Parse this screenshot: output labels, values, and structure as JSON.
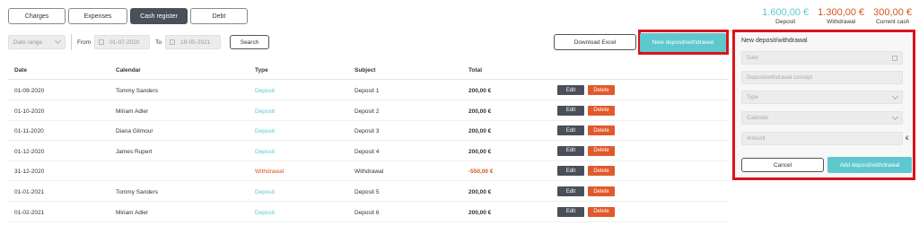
{
  "tabs": [
    {
      "label": "Charges"
    },
    {
      "label": "Expenses"
    },
    {
      "label": "Cash register"
    },
    {
      "label": "Debt"
    }
  ],
  "totals": {
    "deposit": {
      "amount": "1.600,00 €",
      "caption": "Deposit",
      "color": "#5ec8cf"
    },
    "withdrawal": {
      "amount": "1.300,00 €",
      "caption": "Withdrawal",
      "color": "#d9531e"
    },
    "current": {
      "amount": "300,00 €",
      "caption": "Current cash",
      "color": "#d9531e"
    }
  },
  "filters": {
    "date_range_placeholder": "Date range",
    "from_label": "From",
    "from_value": "01-07-2020",
    "to_label": "To",
    "to_value": "19-05-2021",
    "search_label": "Search"
  },
  "actions": {
    "download_excel": "Download Excel",
    "new_entry": "New deposit/withdrawal"
  },
  "table": {
    "headers": [
      "Date",
      "Calendar",
      "Type",
      "Subject",
      "Total"
    ],
    "edit_label": "Edit",
    "delete_label": "Delete",
    "rows": [
      {
        "date": "01-09-2020",
        "calendar": "Tommy Sanders",
        "type": "Deposit",
        "subject": "Deposit 1",
        "total": "200,00 €"
      },
      {
        "date": "01-10-2020",
        "calendar": "Miriam Adler",
        "type": "Deposit",
        "subject": "Deposit 2",
        "total": "200,00 €"
      },
      {
        "date": "01-11-2020",
        "calendar": "Diana Gilmour",
        "type": "Deposit",
        "subject": "Deposit 3",
        "total": "200,00 €"
      },
      {
        "date": "01-12-2020",
        "calendar": "James Rupert",
        "type": "Deposit",
        "subject": "Deposit 4",
        "total": "200,00 €"
      },
      {
        "date": "31-12-2020",
        "calendar": "",
        "type": "Withdrawal",
        "subject": "Withdrawal",
        "total": "-550,00 €"
      },
      {
        "date": "01-01-2021",
        "calendar": "Tommy Sanders",
        "type": "Deposit",
        "subject": "Deposit 5",
        "total": "200,00 €"
      },
      {
        "date": "01-02-2021",
        "calendar": "Miriam Adler",
        "type": "Deposit",
        "subject": "Deposit 6",
        "total": "200,00 €"
      }
    ]
  },
  "panel": {
    "title": "New deposit/withdrawal",
    "date_placeholder": "Date",
    "concept_placeholder": "Deposit/withdrawal concept",
    "type_placeholder": "Type",
    "calendar_placeholder": "Calendar",
    "amount_placeholder": "Amount",
    "currency": "€",
    "cancel_label": "Cancel",
    "add_label": "Add deposit/withdrawal"
  },
  "colors": {
    "accent": "#5ec8cf",
    "dark": "#4a4f5a",
    "danger": "#e05a2b",
    "highlight_frame": "#d9141b",
    "deposit_text": "#5ec8cf",
    "withdrawal_text": "#d9531e"
  }
}
